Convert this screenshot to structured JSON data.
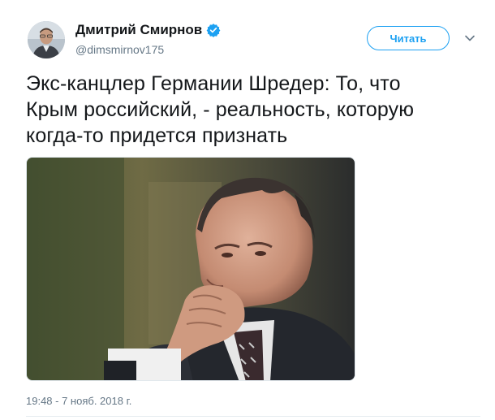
{
  "author": {
    "name": "Дмитрий Смирнов",
    "handle": "@dimsmirnov175",
    "verified_icon": "verified-badge-icon",
    "avatar_icon": "avatar"
  },
  "actions": {
    "follow_label": "Читать",
    "menu_icon": "chevron-down-icon"
  },
  "tweet": {
    "text_lines": [
      "Экс-канцлер Германии Шредер: То, что",
      "Крым российский, - реальность, которую",
      "когда-то придется признать"
    ],
    "media_alt_icon": "photo-of-man",
    "timestamp": "19:48 - 7 нояб. 2018 г."
  },
  "colors": {
    "accent": "#1da1f2",
    "text": "#14171a",
    "secondary": "#657786"
  }
}
